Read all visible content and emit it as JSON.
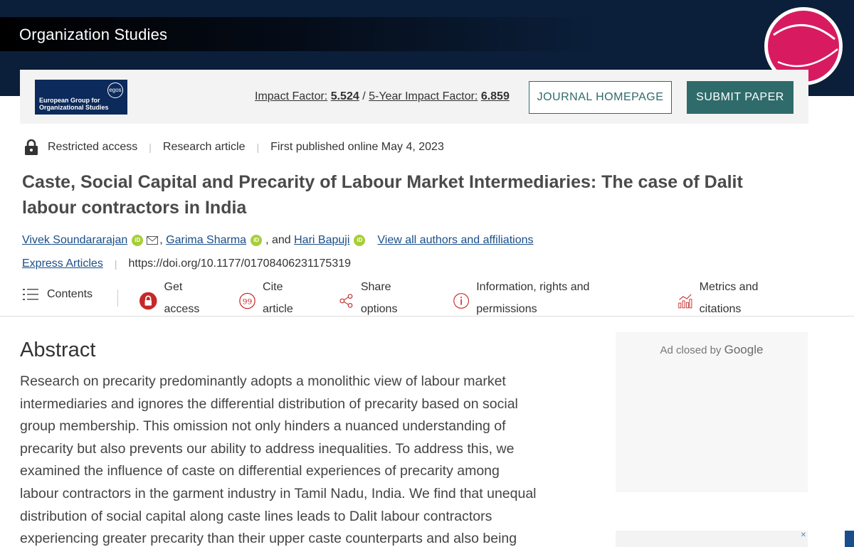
{
  "header": {
    "journal_title": "Organization Studies"
  },
  "egos": {
    "badge": "egos",
    "name": "European Group for Organizational Studies"
  },
  "metrics": {
    "impact_label": "Impact Factor:",
    "impact_value": "5.524",
    "divider": "/",
    "five_year_label": "5-Year Impact Factor:",
    "five_year_value": "6.859"
  },
  "buttons": {
    "homepage": "JOURNAL HOMEPAGE",
    "submit": "SUBMIT PAPER"
  },
  "meta": {
    "access": "Restricted access",
    "type": "Research article",
    "published": "First published online May 4, 2023"
  },
  "article": {
    "title": "Caste, Social Capital and Precarity of Labour Market Intermediaries: The case of Dalit labour contractors in India"
  },
  "authors": {
    "a1": "Vivek Soundararajan",
    "a2": "Garima Sharma",
    "a3": "Hari Bapuji",
    "comma": ",",
    "and": ", and",
    "view_all": "View all authors and affiliations"
  },
  "doi": {
    "collection": "Express Articles",
    "url": "https://doi.org/10.1177/01708406231175319"
  },
  "toolbar": {
    "contents": "Contents",
    "get_access": "Get access",
    "cite": "Cite article",
    "share": "Share options",
    "info": "Information, rights and permissions",
    "metrics": "Metrics and citations"
  },
  "abstract": {
    "heading": "Abstract",
    "text": "Research on precarity predominantly adopts a monolithic view of labour market intermediaries and ignores the differential distribution of precarity based on social group membership. This omission not only hinders a nuanced understanding of precarity but also prevents our ability to address inequalities. To address this, we examined the influence of caste on differential experiences of precarity among labour contractors in the garment industry in Tamil Nadu, India. We find that unequal distribution of social capital along caste lines leads to Dalit labour contractors experiencing greater precarity than their upper caste counterparts and also being"
  },
  "ad": {
    "closed_by": "Ad closed by",
    "google": "Google",
    "close_mark": "✕"
  },
  "colors": {
    "banner": "#0b1f3a",
    "accent": "#2f6b6b",
    "link": "#1a4e8a",
    "orcid": "#a6ce39",
    "lock_red": "#c62828",
    "logo_pink": "#d81b60"
  }
}
